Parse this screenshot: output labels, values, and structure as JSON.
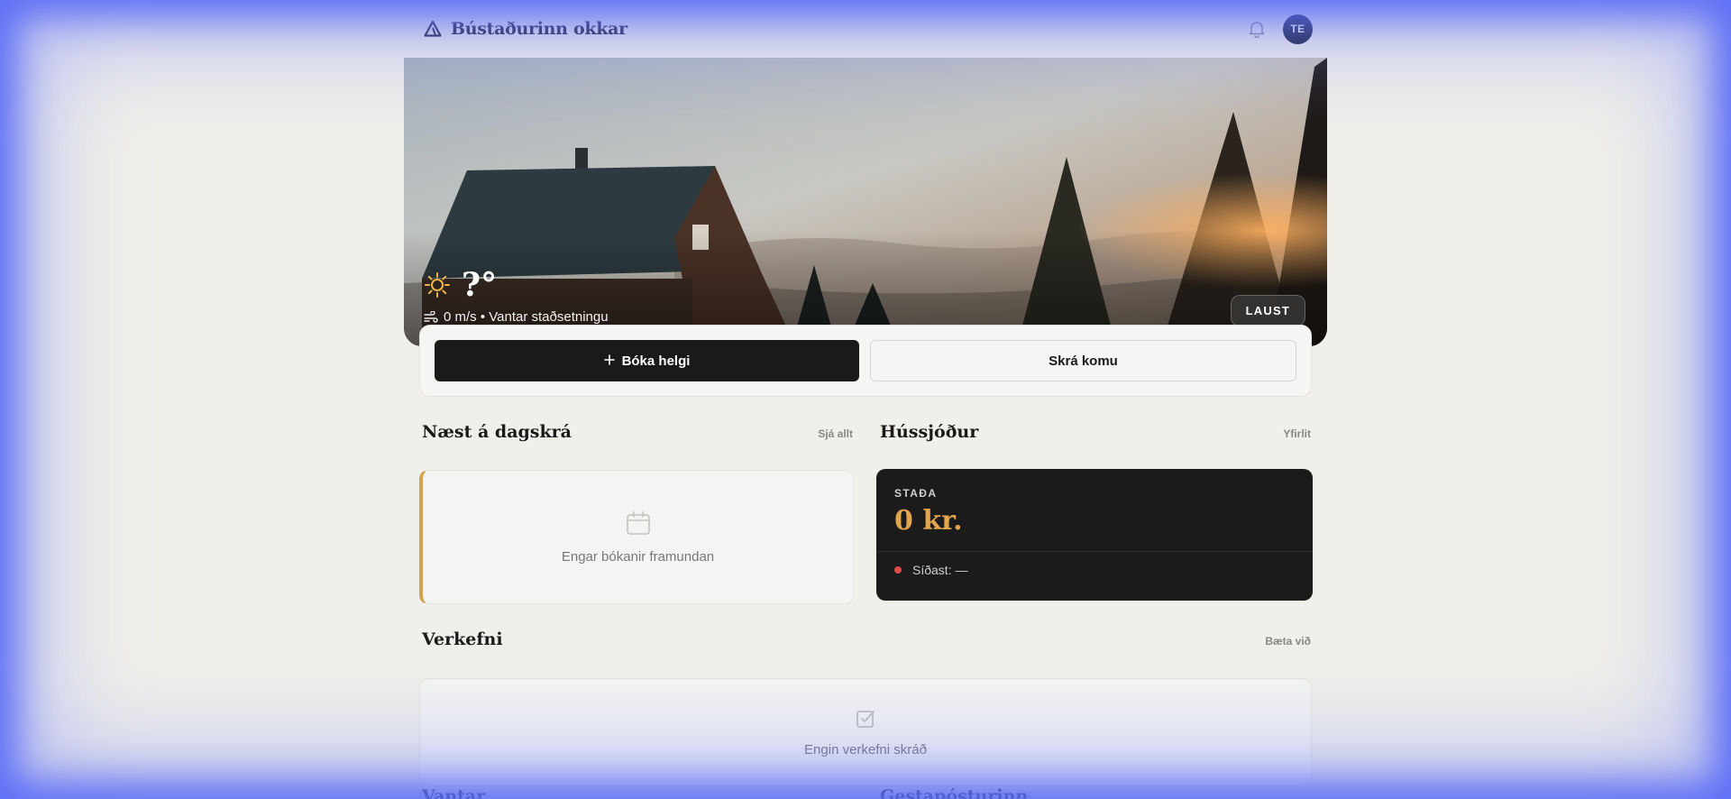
{
  "header": {
    "title": "Bústaðurinn okkar",
    "avatar_initials": "TE"
  },
  "hero": {
    "temperature": "?°",
    "weather_info": "0 m/s • Vantar staðsetningu",
    "status": "LAUST"
  },
  "actions": {
    "book_label": "Bóka helgi",
    "checkin_label": "Skrá komu"
  },
  "schedule": {
    "title": "Næst á dagskrá",
    "link": "Sjá allt",
    "empty": "Engar bókanir framundan"
  },
  "fund": {
    "title": "Hússjóður",
    "link": "Yfirlit",
    "label": "STAÐA",
    "amount": "0 kr.",
    "last": "Síðast: —"
  },
  "tasks": {
    "title": "Verkefni",
    "link": "Bæta við",
    "empty": "Engin verkefni skráð"
  },
  "below": {
    "left_title": "Vantar",
    "right_title": "Gestapósturinn"
  },
  "colors": {
    "accent": "#e0a54d",
    "dark": "#1b1b1b",
    "avatar": "#1d2440",
    "status_dot": "#e04848"
  }
}
